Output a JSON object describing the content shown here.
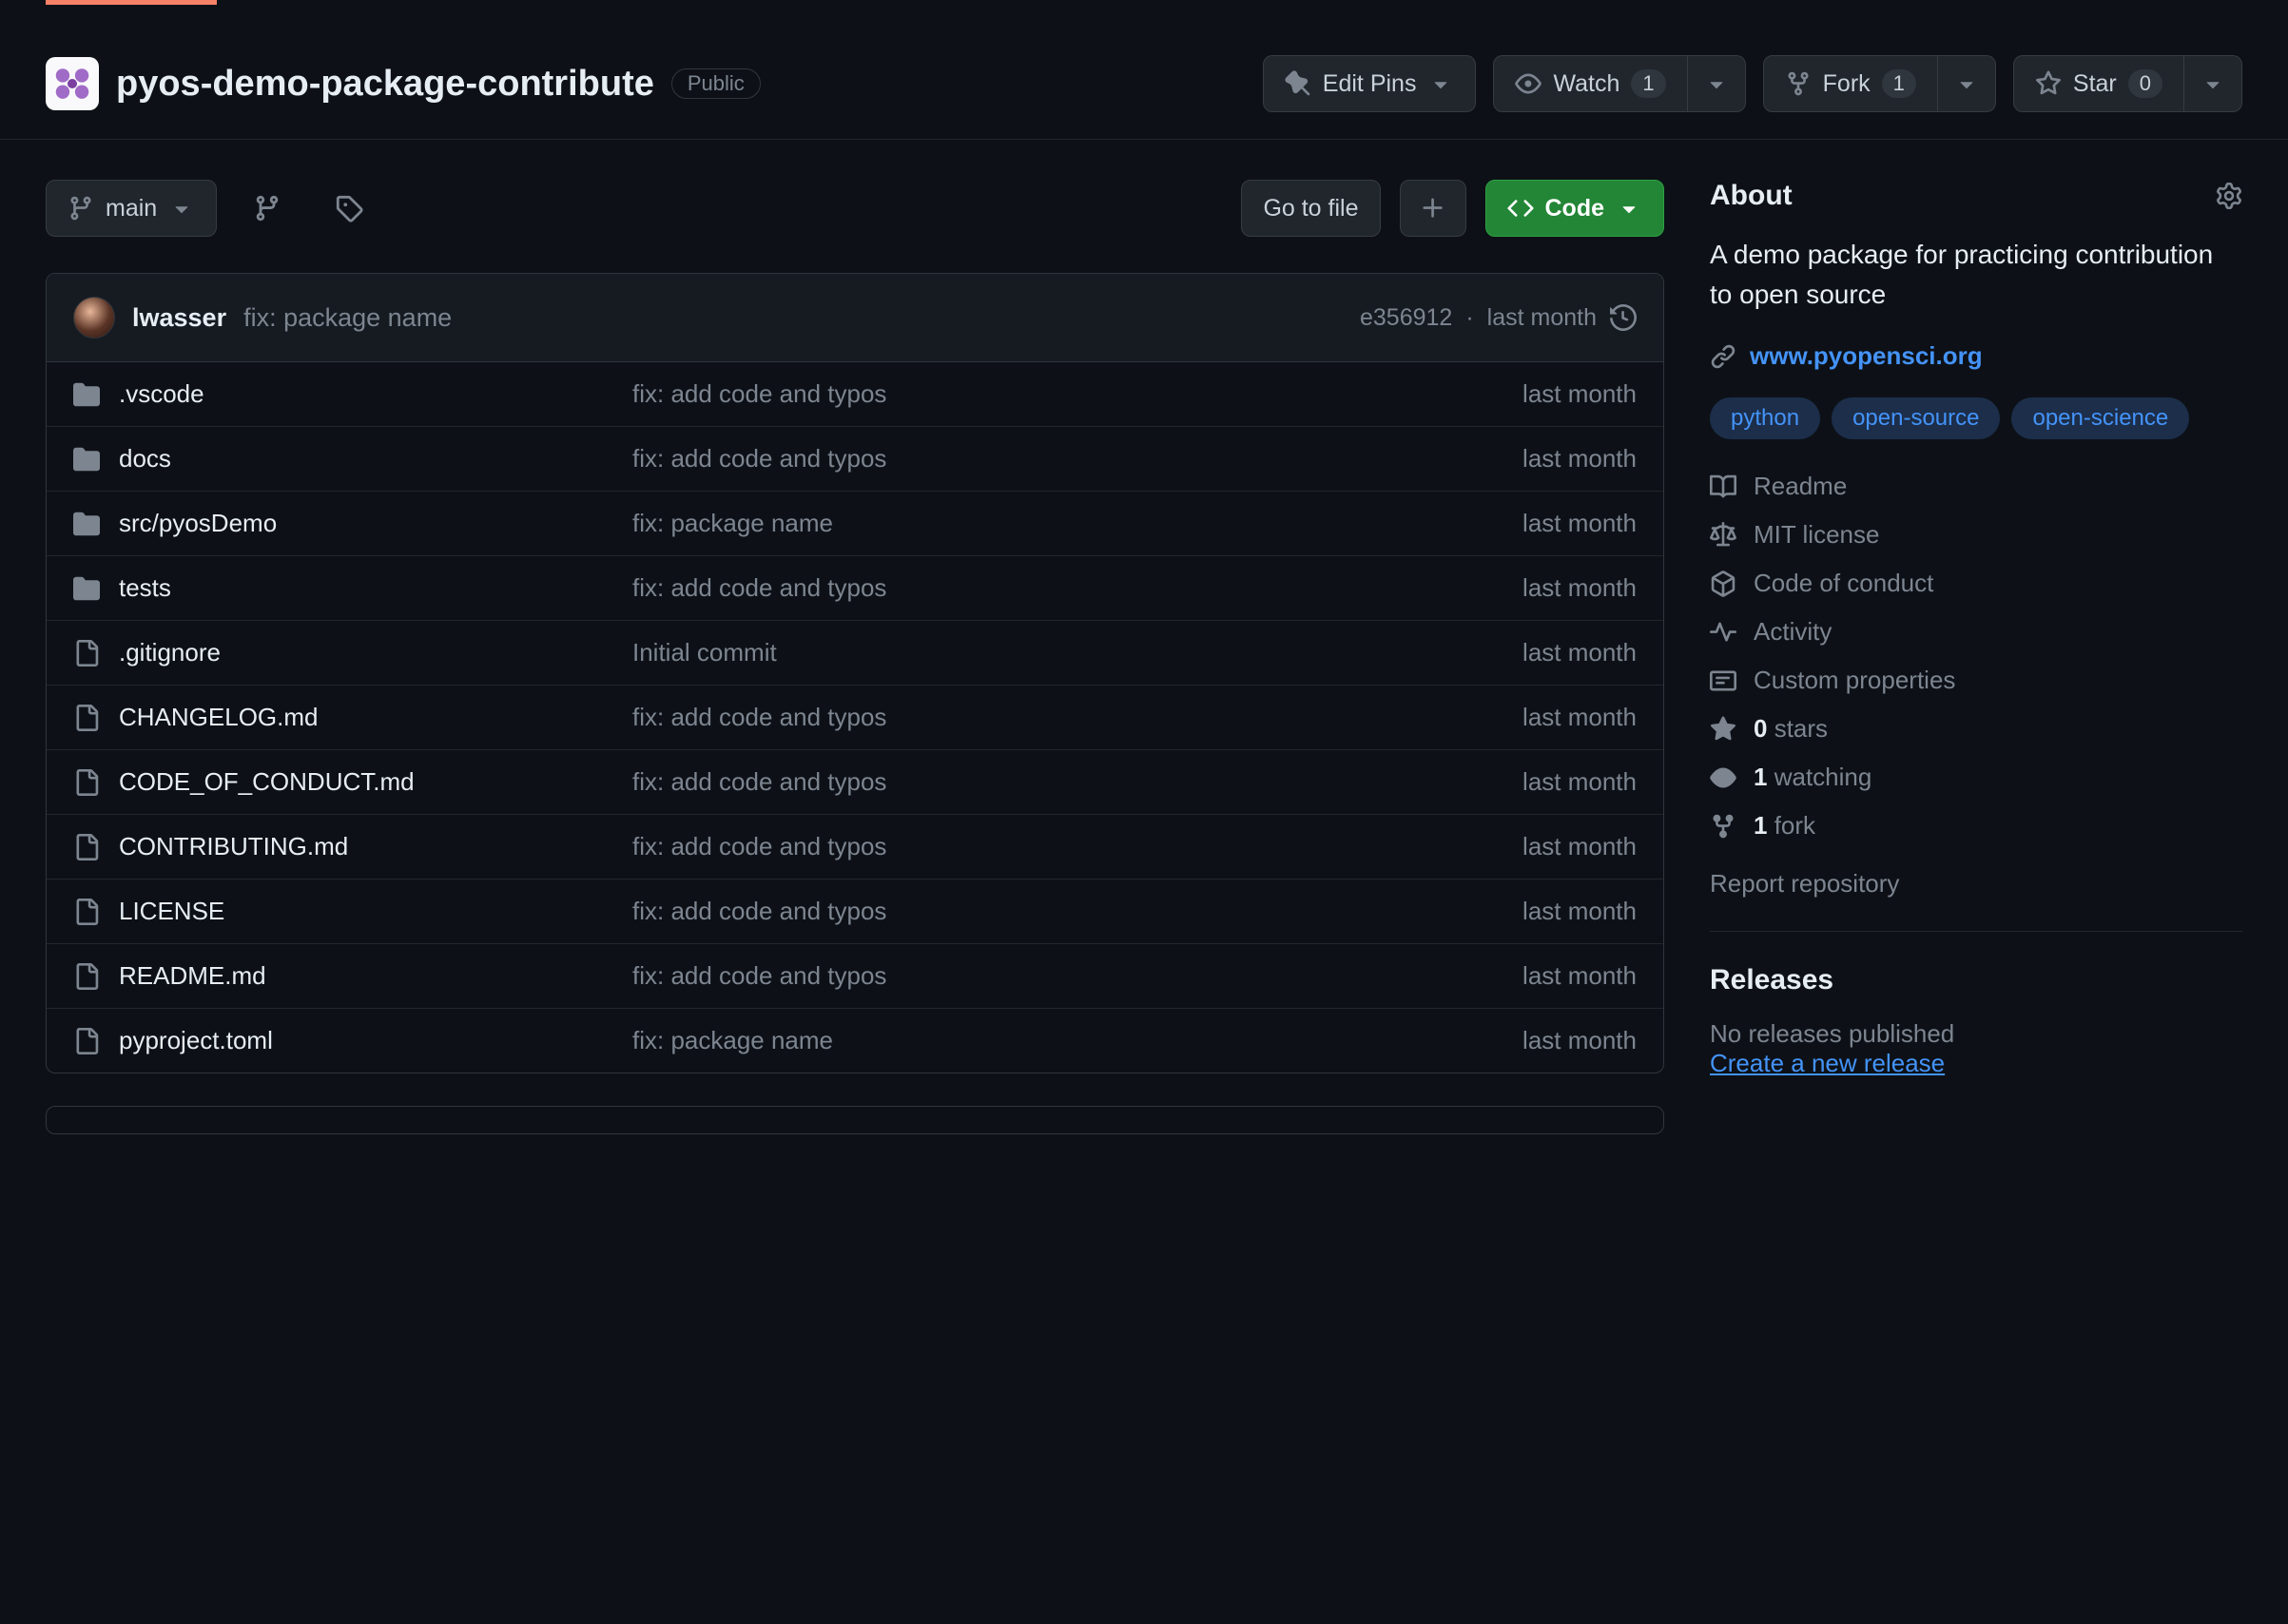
{
  "header": {
    "repoName": "pyos-demo-package-contribute",
    "visibility": "Public",
    "editPins": "Edit Pins",
    "watch": "Watch",
    "watchCount": "1",
    "fork": "Fork",
    "forkCount": "1",
    "star": "Star",
    "starCount": "0"
  },
  "toolbar": {
    "branch": "main",
    "goToFile": "Go to file",
    "code": "Code"
  },
  "commit": {
    "author": "lwasser",
    "message": "fix: package name",
    "sha": "e356912",
    "sep": "·",
    "time": "last month"
  },
  "files": [
    {
      "type": "dir",
      "name": ".vscode",
      "msg": "fix: add code and typos",
      "time": "last month"
    },
    {
      "type": "dir",
      "name": "docs",
      "msg": "fix: add code and typos",
      "time": "last month"
    },
    {
      "type": "dir",
      "name": "src/pyosDemo",
      "msg": "fix: package name",
      "time": "last month"
    },
    {
      "type": "dir",
      "name": "tests",
      "msg": "fix: add code and typos",
      "time": "last month"
    },
    {
      "type": "file",
      "name": ".gitignore",
      "msg": "Initial commit",
      "time": "last month"
    },
    {
      "type": "file",
      "name": "CHANGELOG.md",
      "msg": "fix: add code and typos",
      "time": "last month"
    },
    {
      "type": "file",
      "name": "CODE_OF_CONDUCT.md",
      "msg": "fix: add code and typos",
      "time": "last month"
    },
    {
      "type": "file",
      "name": "CONTRIBUTING.md",
      "msg": "fix: add code and typos",
      "time": "last month"
    },
    {
      "type": "file",
      "name": "LICENSE",
      "msg": "fix: add code and typos",
      "time": "last month"
    },
    {
      "type": "file",
      "name": "README.md",
      "msg": "fix: add code and typos",
      "time": "last month"
    },
    {
      "type": "file",
      "name": "pyproject.toml",
      "msg": "fix: package name",
      "time": "last month"
    }
  ],
  "about": {
    "title": "About",
    "description": "A demo package for practicing contribution to open source",
    "website": "www.pyopensci.org",
    "topics": [
      "python",
      "open-source",
      "open-science"
    ],
    "readme": "Readme",
    "license": "MIT license",
    "coc": "Code of conduct",
    "activity": "Activity",
    "customProps": "Custom properties",
    "starsNum": "0",
    "starsText": "stars",
    "watchingNum": "1",
    "watchingText": "watching",
    "forksNum": "1",
    "forksText": "fork",
    "report": "Report repository"
  },
  "releases": {
    "title": "Releases",
    "noneText": "No releases published",
    "createLink": "Create a new release"
  }
}
